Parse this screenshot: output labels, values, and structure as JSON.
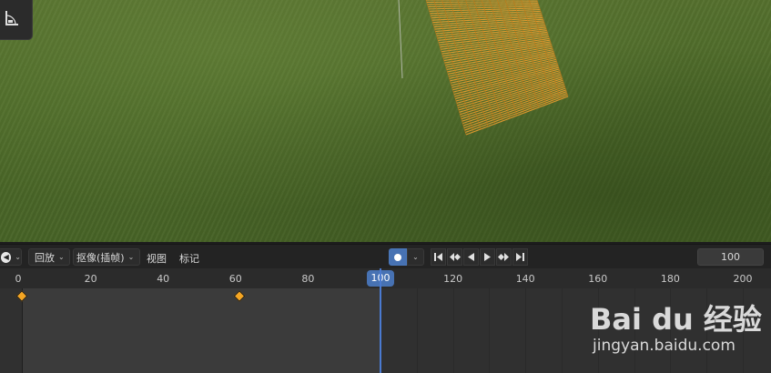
{
  "header": {
    "playback_label": "回放",
    "keying_label": "抠像(插帧)",
    "view_label": "视图",
    "marker_label": "标记",
    "current_frame": "100"
  },
  "ruler": {
    "frames": [
      0,
      20,
      40,
      60,
      80,
      100,
      120,
      140,
      160,
      180,
      200
    ],
    "labels": [
      "0",
      "20",
      "40",
      "60",
      "80",
      "100",
      "120",
      "140",
      "160",
      "180",
      "200"
    ],
    "current_frame": "100"
  },
  "timeline": {
    "keyframes": [
      0,
      60
    ],
    "current_frame": 100,
    "scene_end": 100
  },
  "icons": {
    "editor_type": "timeline-editor-icon",
    "auto_key": "record-dot-icon",
    "transport": [
      "jump-start-icon",
      "prev-keyframe-icon",
      "play-reverse-icon",
      "play-icon",
      "next-keyframe-icon",
      "jump-end-icon"
    ]
  },
  "colors": {
    "accent": "#4772b3",
    "keyframe": "#f5a623",
    "cloth": "#f0a030"
  },
  "watermark": {
    "logo": "Bai du 经验",
    "url": "jingyan.baidu.com"
  }
}
